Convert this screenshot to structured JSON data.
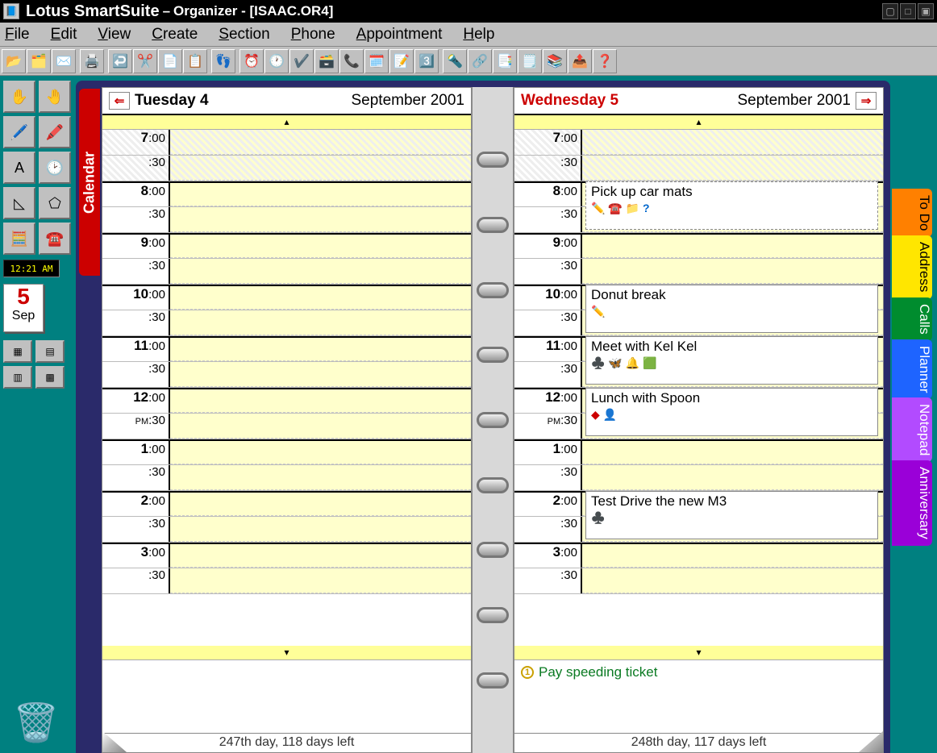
{
  "title": {
    "app": "Lotus SmartSuite",
    "sep": " – ",
    "doc": "Organizer - [ISAAC.OR4]"
  },
  "menus": {
    "file": "File",
    "edit": "Edit",
    "view": "View",
    "create": "Create",
    "section": "Section",
    "phone": "Phone",
    "appointment": "Appointment",
    "help": "Help"
  },
  "clock": "12:21 AM",
  "datepad": {
    "day": "5",
    "month": "Sep"
  },
  "calendar_tab": "Calendar",
  "right_tabs": {
    "todo": "To Do",
    "address": "Address",
    "calls": "Calls",
    "planner": "Planner",
    "notepad": "Notepad",
    "anniversary": "Anniversary"
  },
  "left_page": {
    "day": "Tuesday 4",
    "month": "September 2001",
    "footer": "247th day, 118 days left"
  },
  "right_page": {
    "day": "Wednesday 5",
    "month": "September 2001",
    "footer": "248th day, 117 days left",
    "todo": "Pay speeding ticket"
  },
  "hours": [
    "7",
    "8",
    "9",
    "10",
    "11",
    "12",
    "1",
    "2",
    "3"
  ],
  "pm_label": "PM",
  "half": ":30",
  "zz": ":00",
  "appts": {
    "a1": "Pick up car mats",
    "a2": "Donut break",
    "a3": "Meet with Kel Kel",
    "a4": "Lunch with Spoon",
    "a5": "Test Drive the new M3"
  },
  "scroll_up": "▴",
  "scroll_down": "▾",
  "q": "?"
}
